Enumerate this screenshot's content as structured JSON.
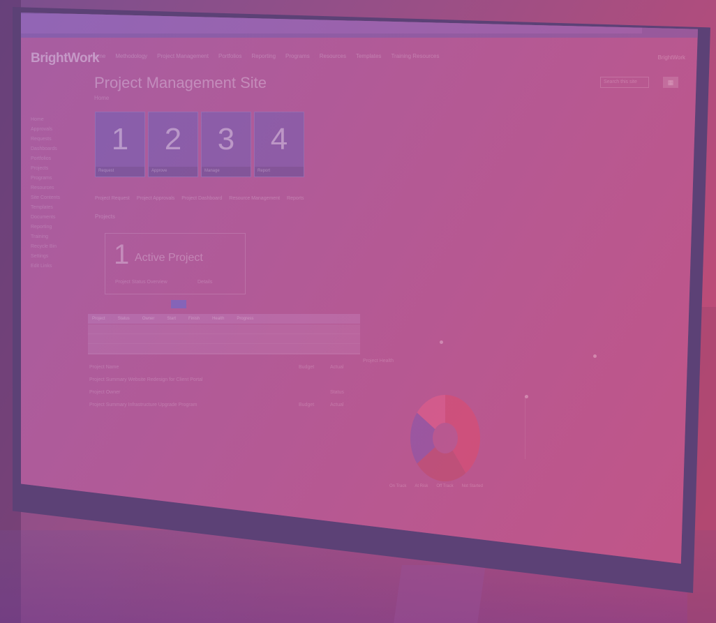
{
  "app": {
    "brand": "BrightWork",
    "user_menu": "BrightWork"
  },
  "nav": {
    "items": [
      "Home",
      "Methodology",
      "Project Management",
      "Portfolios",
      "Reporting",
      "Programs",
      "Resources",
      "Templates",
      "Training Resources"
    ]
  },
  "page": {
    "title": "Project Management Site",
    "breadcrumb": "Home",
    "filter_placeholder": "Search this site",
    "view_icon": "grid-icon"
  },
  "sidebar": {
    "items": [
      "Home",
      "Approvals",
      "Requests",
      "Dashboards",
      "Portfolios",
      "Projects",
      "Programs",
      "Resources",
      "Site Contents",
      "Templates",
      "Documents",
      "Reporting",
      "Training",
      "Recycle Bin",
      "Settings",
      "Edit Links"
    ]
  },
  "tiles": [
    {
      "number": "1",
      "caption": "Request"
    },
    {
      "number": "2",
      "caption": "Approve"
    },
    {
      "number": "3",
      "caption": "Manage"
    },
    {
      "number": "4",
      "caption": "Report"
    }
  ],
  "links": [
    "Project Request",
    "Project Approvals",
    "Project Dashboard",
    "Resource Management",
    "Reports"
  ],
  "summary": {
    "section_title": "Projects",
    "count": "1",
    "label": "Active Project",
    "sub_left": "Project Status Overview",
    "sub_right": "Details"
  },
  "table": {
    "tabs": [
      "Project",
      "Status",
      "Owner",
      "Start",
      "Finish",
      "Health",
      "Progress"
    ]
  },
  "list": {
    "items": [
      {
        "label": "Project Name",
        "amount1": "Budget",
        "amount2": "Actual"
      },
      {
        "label": "Project Summary  Website Redesign for Client Portal",
        "amount1": "",
        "amount2": ""
      },
      {
        "label": "Project Owner",
        "amount1": "",
        "amount2": "Status"
      },
      {
        "label": "Project Summary  Infrastructure Upgrade Program",
        "amount1": "Budget",
        "amount2": "Actual"
      }
    ]
  },
  "right_text": "Project Health",
  "chart_data": {
    "type": "pie",
    "categories": [
      "On Track",
      "At Risk",
      "Off Track",
      "Not Started"
    ],
    "values": [
      40,
      25,
      20,
      15
    ],
    "colors": [
      "#d64d6f",
      "#b94d6a",
      "#7d58ad",
      "#e0608a"
    ]
  },
  "legend": {
    "items": [
      "On Track",
      "At Risk",
      "Off Track",
      "Not Started"
    ]
  }
}
